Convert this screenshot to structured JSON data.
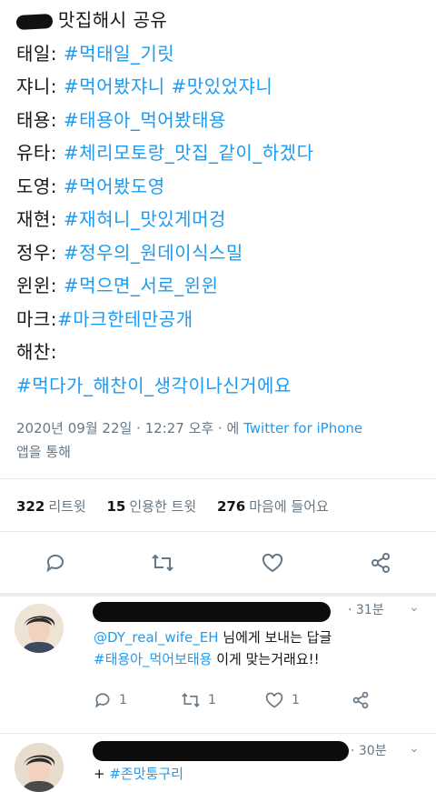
{
  "tweet": {
    "header_text": "맛집해시 공유",
    "lines": [
      {
        "label": "태일:",
        "tag": "#먹태일_기릿"
      },
      {
        "label": "쟈니:",
        "tag": "#먹어봤쟈니 #맛있었쟈니"
      },
      {
        "label": "태용:",
        "tag": "#태용아_먹어봤태용"
      },
      {
        "label": "유타:",
        "tag": "#체리모토랑_맛집_같이_하겠다"
      },
      {
        "label": "도영:",
        "tag": "#먹어봤도영"
      },
      {
        "label": "재현:",
        "tag": "#재혀니_맛있게머겅"
      },
      {
        "label": "정우:",
        "tag": "#정우의_원데이식스밀"
      },
      {
        "label": "윈윈:",
        "tag": "#먹으면_서로_윈윈"
      },
      {
        "label": "마크:",
        "tag": "#마크한테만공개"
      },
      {
        "label": "해찬:",
        "tag": ""
      },
      {
        "label": "",
        "tag": "#먹다가_해찬이_생각이나신거에요"
      }
    ],
    "timestamp": "2020년 09월 22일 · 12:27 오후 · 에",
    "source": "Twitter for iPhone",
    "source_suffix": "앱을 통해"
  },
  "stats": {
    "retweets_count": "322",
    "retweets_label": "리트윗",
    "quotes_count": "15",
    "quotes_label": "인용한 트윗",
    "likes_count": "276",
    "likes_label": "마음에 들어요"
  },
  "icons": [
    "reply-icon",
    "retweet-icon",
    "like-icon",
    "share-icon",
    "chevron-down-icon"
  ],
  "accent_color": "#1d9bf0",
  "replies": [
    {
      "time": "· 31분",
      "mention": "@DY_real_wife_EH",
      "mention_suffix": " 님에게 보내는 답글",
      "tag": "#태용아_먹어보태용",
      "text": " 이게 맞는거래요!!",
      "reply_count": "1",
      "retweet_count": "1",
      "like_count": "1"
    },
    {
      "time": "· 30분",
      "prefix": "+",
      "tag": "#존맛퉁구리"
    }
  ]
}
